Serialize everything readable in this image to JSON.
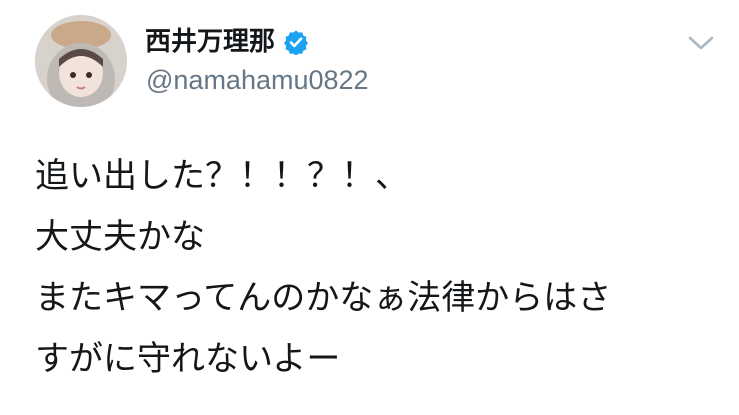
{
  "tweet": {
    "author": {
      "display_name": "西井万理那",
      "handle": "@namahamu0822",
      "verified": true
    },
    "text_lines": [
      "追い出した？！！？！、",
      "大丈夫かな",
      "またキマってんのかなぁ法律からはさ",
      "すがに守れないよー"
    ]
  },
  "colors": {
    "text_primary": "#14171a",
    "text_secondary": "#657786",
    "verified_badge": "#1da1f2",
    "background": "#ffffff"
  },
  "icons": {
    "verified": "verified-badge-icon",
    "menu": "chevron-down-icon"
  }
}
